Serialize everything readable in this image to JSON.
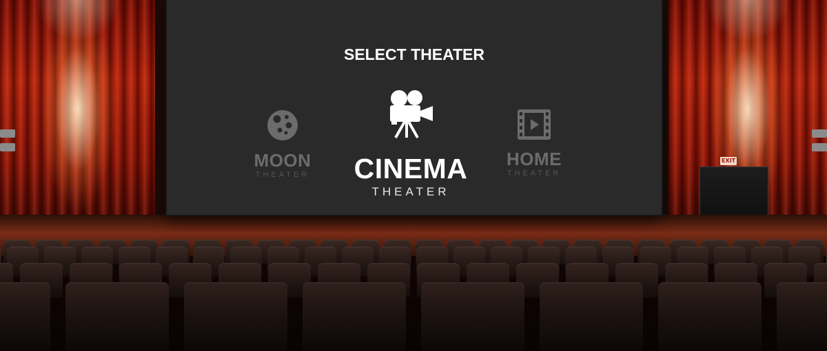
{
  "screen": {
    "title": "SELECT THEATER"
  },
  "options": [
    {
      "name": "MOON",
      "sub": "THEATER",
      "icon": "moon-icon",
      "selected": false
    },
    {
      "name": "CINEMA",
      "sub": "THEATER",
      "icon": "movie-camera-icon",
      "selected": true
    },
    {
      "name": "HOME",
      "sub": "THEATER",
      "icon": "film-strip-play-icon",
      "selected": false
    }
  ],
  "venue": {
    "exit_sign": "EXIT"
  },
  "colors": {
    "screen": "#2a2a2a",
    "selected_text": "#ffffff",
    "unselected_text": "#6c6c6c",
    "curtain": "#b3210c"
  }
}
